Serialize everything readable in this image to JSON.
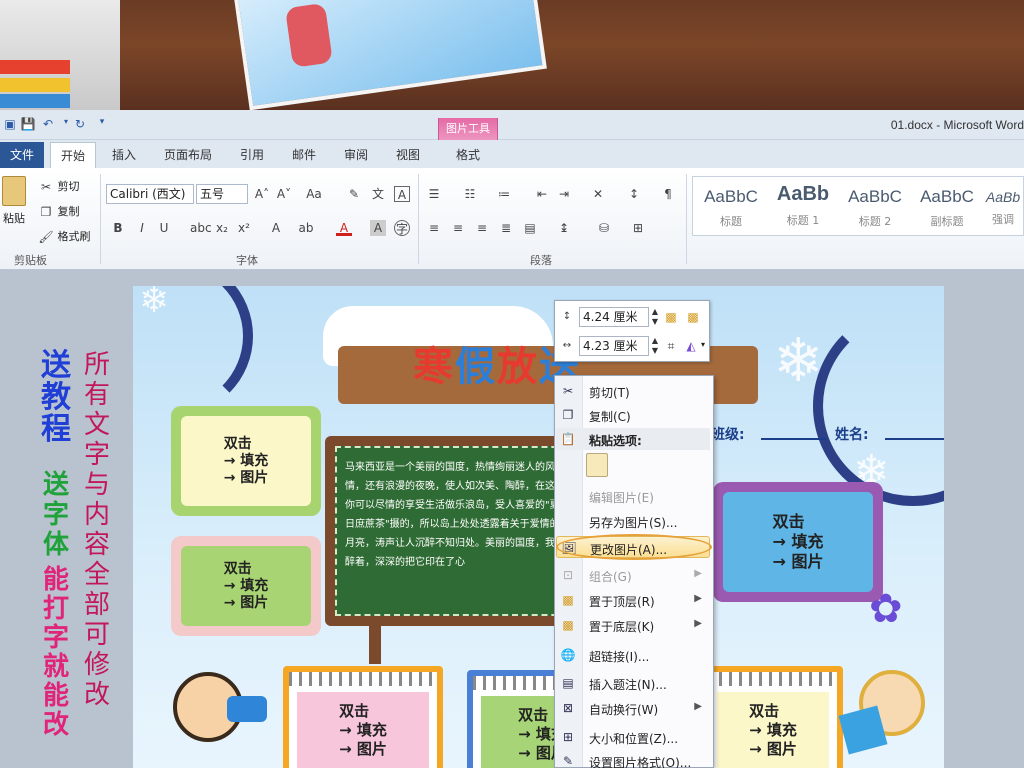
{
  "window": {
    "doc_title": "01.docx  -  Microsoft Word",
    "context_tool_group": "图片工具",
    "context_tab": "格式"
  },
  "tabs": [
    "文件",
    "开始",
    "插入",
    "页面布局",
    "引用",
    "邮件",
    "审阅",
    "视图"
  ],
  "ribbon": {
    "clipboard": {
      "paste": "粘贴",
      "cut": "剪切",
      "copy": "复制",
      "format_painter": "格式刷",
      "group_label": "剪贴板"
    },
    "font": {
      "font_name": "Calibri (西文)",
      "font_size": "五号",
      "group_label": "字体"
    },
    "paragraph": {
      "group_label": "段落"
    },
    "styles": [
      {
        "preview": "AaBbC",
        "label": "标题"
      },
      {
        "preview": "AaBb",
        "label": "标题 1"
      },
      {
        "preview": "AaBbC",
        "label": "标题 2"
      },
      {
        "preview": "AaBbC",
        "label": "副标题"
      },
      {
        "preview": "AaBb",
        "label": "强调"
      }
    ]
  },
  "size_toolbar": {
    "height": "4.24 厘米",
    "width": "4.23 厘米"
  },
  "context_menu": {
    "items": [
      {
        "label": "剪切(T)",
        "enabled": true
      },
      {
        "label": "复制(C)",
        "enabled": true
      },
      {
        "label": "粘贴选项:",
        "enabled": true
      },
      {
        "label": "编辑图片(E)",
        "enabled": false
      },
      {
        "label": "另存为图片(S)...",
        "enabled": true
      },
      {
        "label": "更改图片(A)...",
        "enabled": true,
        "highlighted": true
      },
      {
        "label": "组合(G)",
        "enabled": false,
        "submenu": true
      },
      {
        "label": "置于顶层(R)",
        "enabled": true,
        "submenu": true
      },
      {
        "label": "置于底层(K)",
        "enabled": true,
        "submenu": true
      },
      {
        "label": "超链接(I)...",
        "enabled": true
      },
      {
        "label": "插入题注(N)...",
        "enabled": true
      },
      {
        "label": "自动换行(W)",
        "enabled": true,
        "submenu": true
      },
      {
        "label": "大小和位置(Z)...",
        "enabled": true
      },
      {
        "label": "设置图片格式(O)...",
        "enabled": true
      }
    ]
  },
  "poster": {
    "title": [
      "寒",
      "假",
      "放",
      "送"
    ],
    "class_label": "班级:",
    "name_label": "姓名:",
    "placeholder": "双击\n→ 填充\n→ 图片",
    "board_text": "马来西亚是一个美丽的国度，热情绚丽迷人的风情，还有浪漫的夜晚，使人如次美、陶醉，在这里你可以尽情的享受生活做乐浪岛，受人喜爱的\"夏日庶蔗茶\"摄的，所以岛上处处透露着关于爱情的月亮，涛声让人沉醉不知归处。美丽的国度，我陶醉着，深深的把它印在了心"
  },
  "promo": {
    "col1": [
      "送",
      "教",
      "程"
    ],
    "col1b": [
      "送",
      "字",
      "体"
    ],
    "col1c": [
      "能",
      "打",
      "字",
      "就",
      "能",
      "改"
    ],
    "col2": "所有文字与内容全部可修改",
    "colors": {
      "blue": "#1f3fd6",
      "green": "#1fa23a",
      "pink": "#e0247a",
      "red": "#c2185b"
    }
  }
}
